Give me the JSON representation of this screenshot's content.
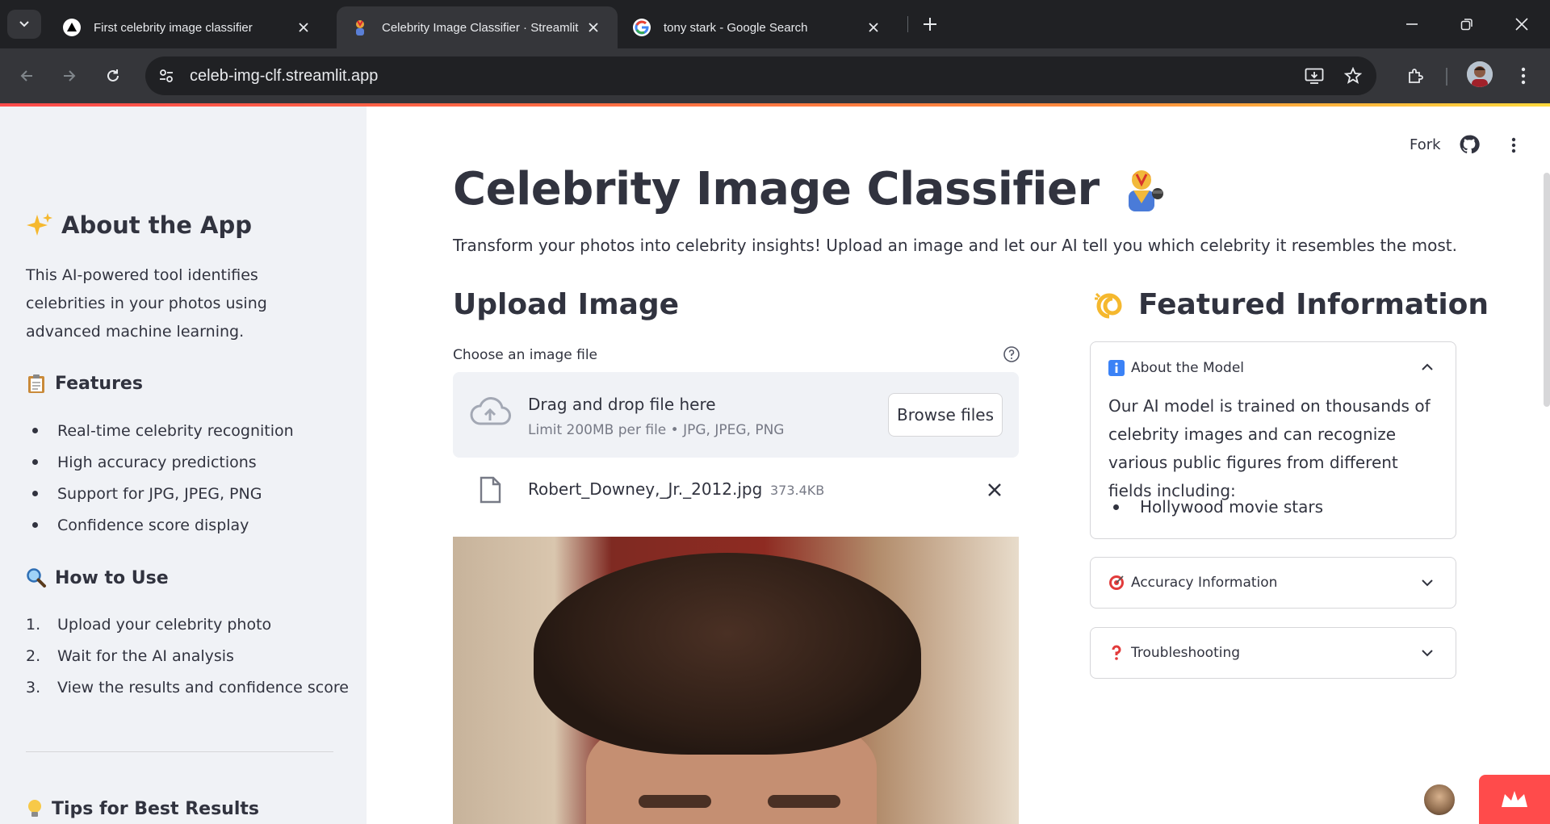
{
  "browser": {
    "tabs": [
      {
        "title": "First celebrity image classifier"
      },
      {
        "title": "Celebrity Image Classifier · Streamlit"
      },
      {
        "title": "tony stark - Google Search"
      }
    ],
    "url": "celeb-img-clf.streamlit.app"
  },
  "header": {
    "fork_label": "Fork"
  },
  "sidebar": {
    "about_title": "About the App",
    "about_text": "This AI-powered tool identifies celebrities in your photos using advanced machine learning.",
    "features_title": "Features",
    "features": [
      "Real-time celebrity recognition",
      "High accuracy predictions",
      "Support for JPG, JPEG, PNG",
      "Confidence score display"
    ],
    "howto_title": "How to Use",
    "steps": [
      {
        "num": "1.",
        "text": "Upload your celebrity photo"
      },
      {
        "num": "2.",
        "text": "Wait for the AI analysis"
      },
      {
        "num": "3.",
        "text": "View the results and confidence score"
      }
    ],
    "tips_title": "Tips for Best Results"
  },
  "main": {
    "title": "Celebrity Image Classifier",
    "subtitle": "Transform your photos into celebrity insights! Upload an image and let our AI tell you which celebrity it resembles the most.",
    "upload_heading": "Upload Image",
    "uploader_label": "Choose an image file",
    "dropzone_text": "Drag and drop file here",
    "dropzone_limit": "Limit 200MB per file • JPG, JPEG, PNG",
    "browse_label": "Browse files",
    "file_name": "Robert_Downey,_Jr._2012.jpg",
    "file_size": "373.4KB"
  },
  "featured": {
    "heading": "Featured Information",
    "about_model": {
      "title": "About the Model",
      "body": "Our AI model is trained on thousands of celebrity images and can recognize various public figures from different fields including:",
      "bullet": "Hollywood movie stars"
    },
    "accuracy_title": "Accuracy Information",
    "troubleshooting_title": "Troubleshooting"
  },
  "colors": {
    "accent": "#ff4b4b",
    "sidebar_bg": "#f0f2f6",
    "text": "#31333f",
    "chrome_dark": "#202124"
  }
}
